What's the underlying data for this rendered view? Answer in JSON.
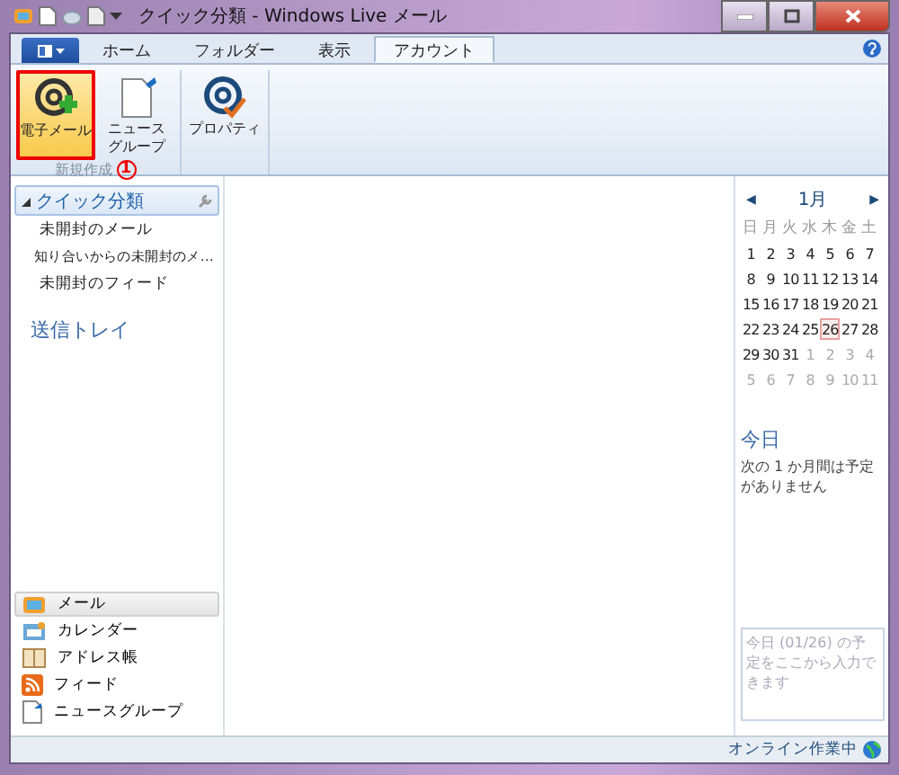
{
  "window": {
    "title": "クイック分類 - Windows Live メール"
  },
  "tabs": [
    {
      "label": "ホーム",
      "selected": false
    },
    {
      "label": "フォルダー",
      "selected": false
    },
    {
      "label": "表示",
      "selected": false
    },
    {
      "label": "アカウント",
      "selected": true
    }
  ],
  "ribbon": {
    "groups": [
      {
        "label": "新規作成",
        "buttons": [
          {
            "lines": [
              "電子メール"
            ],
            "kind": "email",
            "highlighted": true
          },
          {
            "lines": [
              "ニュース",
              "グループ"
            ],
            "kind": "newsgroup",
            "highlighted": false
          }
        ]
      },
      {
        "buttons": [
          {
            "lines": [
              "プロパティ"
            ],
            "kind": "properties",
            "highlighted": false
          }
        ]
      }
    ]
  },
  "annotation": {
    "step": "1"
  },
  "quick_views": {
    "title": "クイック分類",
    "expanded": true,
    "items": [
      {
        "label": "未開封のメール"
      },
      {
        "label": "知り合いからの未開封のメ…"
      },
      {
        "label": "未開封のフィード"
      }
    ]
  },
  "outbox": "送信トレイ",
  "nav": [
    {
      "label": "メール",
      "kind": "mail",
      "selected": true
    },
    {
      "label": "カレンダー",
      "kind": "calendar",
      "selected": false
    },
    {
      "label": "アドレス帳",
      "kind": "contacts",
      "selected": false
    },
    {
      "label": "フィード",
      "kind": "feeds",
      "selected": false
    },
    {
      "label": "ニュースグループ",
      "kind": "newsgroups",
      "selected": false
    }
  ],
  "calendar": {
    "prev": "◀",
    "next": "▶",
    "month": "1月",
    "weekdays": [
      "日",
      "月",
      "火",
      "水",
      "木",
      "金",
      "土"
    ],
    "days": [
      {
        "d": "1",
        "other": false,
        "today": false
      },
      {
        "d": "2",
        "other": false,
        "today": false
      },
      {
        "d": "3",
        "other": false,
        "today": false
      },
      {
        "d": "4",
        "other": false,
        "today": false
      },
      {
        "d": "5",
        "other": false,
        "today": false
      },
      {
        "d": "6",
        "other": false,
        "today": false
      },
      {
        "d": "7",
        "other": false,
        "today": false
      },
      {
        "d": "8",
        "other": false,
        "today": false
      },
      {
        "d": "9",
        "other": false,
        "today": false
      },
      {
        "d": "10",
        "other": false,
        "today": false
      },
      {
        "d": "11",
        "other": false,
        "today": false
      },
      {
        "d": "12",
        "other": false,
        "today": false
      },
      {
        "d": "13",
        "other": false,
        "today": false
      },
      {
        "d": "14",
        "other": false,
        "today": false
      },
      {
        "d": "15",
        "other": false,
        "today": false
      },
      {
        "d": "16",
        "other": false,
        "today": false
      },
      {
        "d": "17",
        "other": false,
        "today": false
      },
      {
        "d": "18",
        "other": false,
        "today": false
      },
      {
        "d": "19",
        "other": false,
        "today": false
      },
      {
        "d": "20",
        "other": false,
        "today": false
      },
      {
        "d": "21",
        "other": false,
        "today": false
      },
      {
        "d": "22",
        "other": false,
        "today": false
      },
      {
        "d": "23",
        "other": false,
        "today": false
      },
      {
        "d": "24",
        "other": false,
        "today": false
      },
      {
        "d": "25",
        "other": false,
        "today": false
      },
      {
        "d": "26",
        "other": false,
        "today": true
      },
      {
        "d": "27",
        "other": false,
        "today": false
      },
      {
        "d": "28",
        "other": false,
        "today": false
      },
      {
        "d": "29",
        "other": false,
        "today": false
      },
      {
        "d": "30",
        "other": false,
        "today": false
      },
      {
        "d": "31",
        "other": false,
        "today": false
      },
      {
        "d": "1",
        "other": true,
        "today": false
      },
      {
        "d": "2",
        "other": true,
        "today": false
      },
      {
        "d": "3",
        "other": true,
        "today": false
      },
      {
        "d": "4",
        "other": true,
        "today": false
      },
      {
        "d": "5",
        "other": true,
        "today": false
      },
      {
        "d": "6",
        "other": true,
        "today": false
      },
      {
        "d": "7",
        "other": true,
        "today": false
      },
      {
        "d": "8",
        "other": true,
        "today": false
      },
      {
        "d": "9",
        "other": true,
        "today": false
      },
      {
        "d": "10",
        "other": true,
        "today": false
      },
      {
        "d": "11",
        "other": true,
        "today": false
      }
    ]
  },
  "today": {
    "title": "今日",
    "message": "次の 1 か月間は予定がありません"
  },
  "quick_add": {
    "placeholder": "今日 (01/26) の予定をここから入力できます"
  },
  "status_bar": {
    "status": "オンライン作業中"
  }
}
